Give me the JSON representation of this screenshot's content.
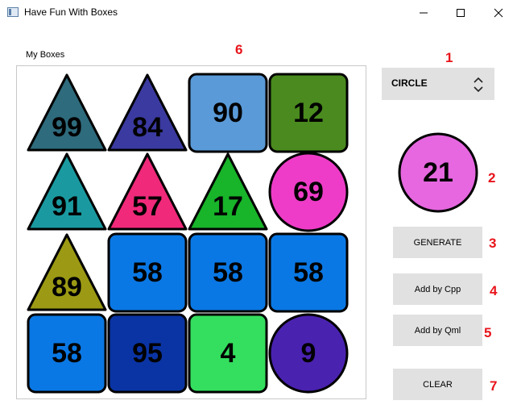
{
  "window": {
    "title": "Have Fun With Boxes"
  },
  "panel": {
    "label": "My Boxes"
  },
  "markers": [
    "1",
    "2",
    "3",
    "4",
    "5",
    "6",
    "7"
  ],
  "combo": {
    "value": "CIRCLE"
  },
  "preview": {
    "shape": "circle",
    "value": "21",
    "color": "#e667e0"
  },
  "buttons": {
    "generate": "GENERATE",
    "add_cpp": "Add by Cpp",
    "add_qml": "Add by Qml",
    "clear": "CLEAR"
  },
  "boxes": [
    {
      "shape": "triangle",
      "value": "99",
      "color": "#2e6b7c"
    },
    {
      "shape": "triangle",
      "value": "84",
      "color": "#3b3aa0"
    },
    {
      "shape": "square",
      "value": "90",
      "color": "#5a9ad8"
    },
    {
      "shape": "square",
      "value": "12",
      "color": "#4a8a1e"
    },
    {
      "shape": "triangle",
      "value": "91",
      "color": "#1a9aa0"
    },
    {
      "shape": "triangle",
      "value": "57",
      "color": "#f0297a"
    },
    {
      "shape": "triangle",
      "value": "17",
      "color": "#18b42a"
    },
    {
      "shape": "circle",
      "value": "69",
      "color": "#ee3cc8"
    },
    {
      "shape": "triangle",
      "value": "89",
      "color": "#9c9a14"
    },
    {
      "shape": "square",
      "value": "58",
      "color": "#0a78e4"
    },
    {
      "shape": "square",
      "value": "58",
      "color": "#0a78e4"
    },
    {
      "shape": "square",
      "value": "58",
      "color": "#0a78e4"
    },
    {
      "shape": "square",
      "value": "58",
      "color": "#0a78e4"
    },
    {
      "shape": "square",
      "value": "95",
      "color": "#0a34a4"
    },
    {
      "shape": "square",
      "value": "4",
      "color": "#34de5e"
    },
    {
      "shape": "circle",
      "value": "9",
      "color": "#4a22b0"
    }
  ]
}
